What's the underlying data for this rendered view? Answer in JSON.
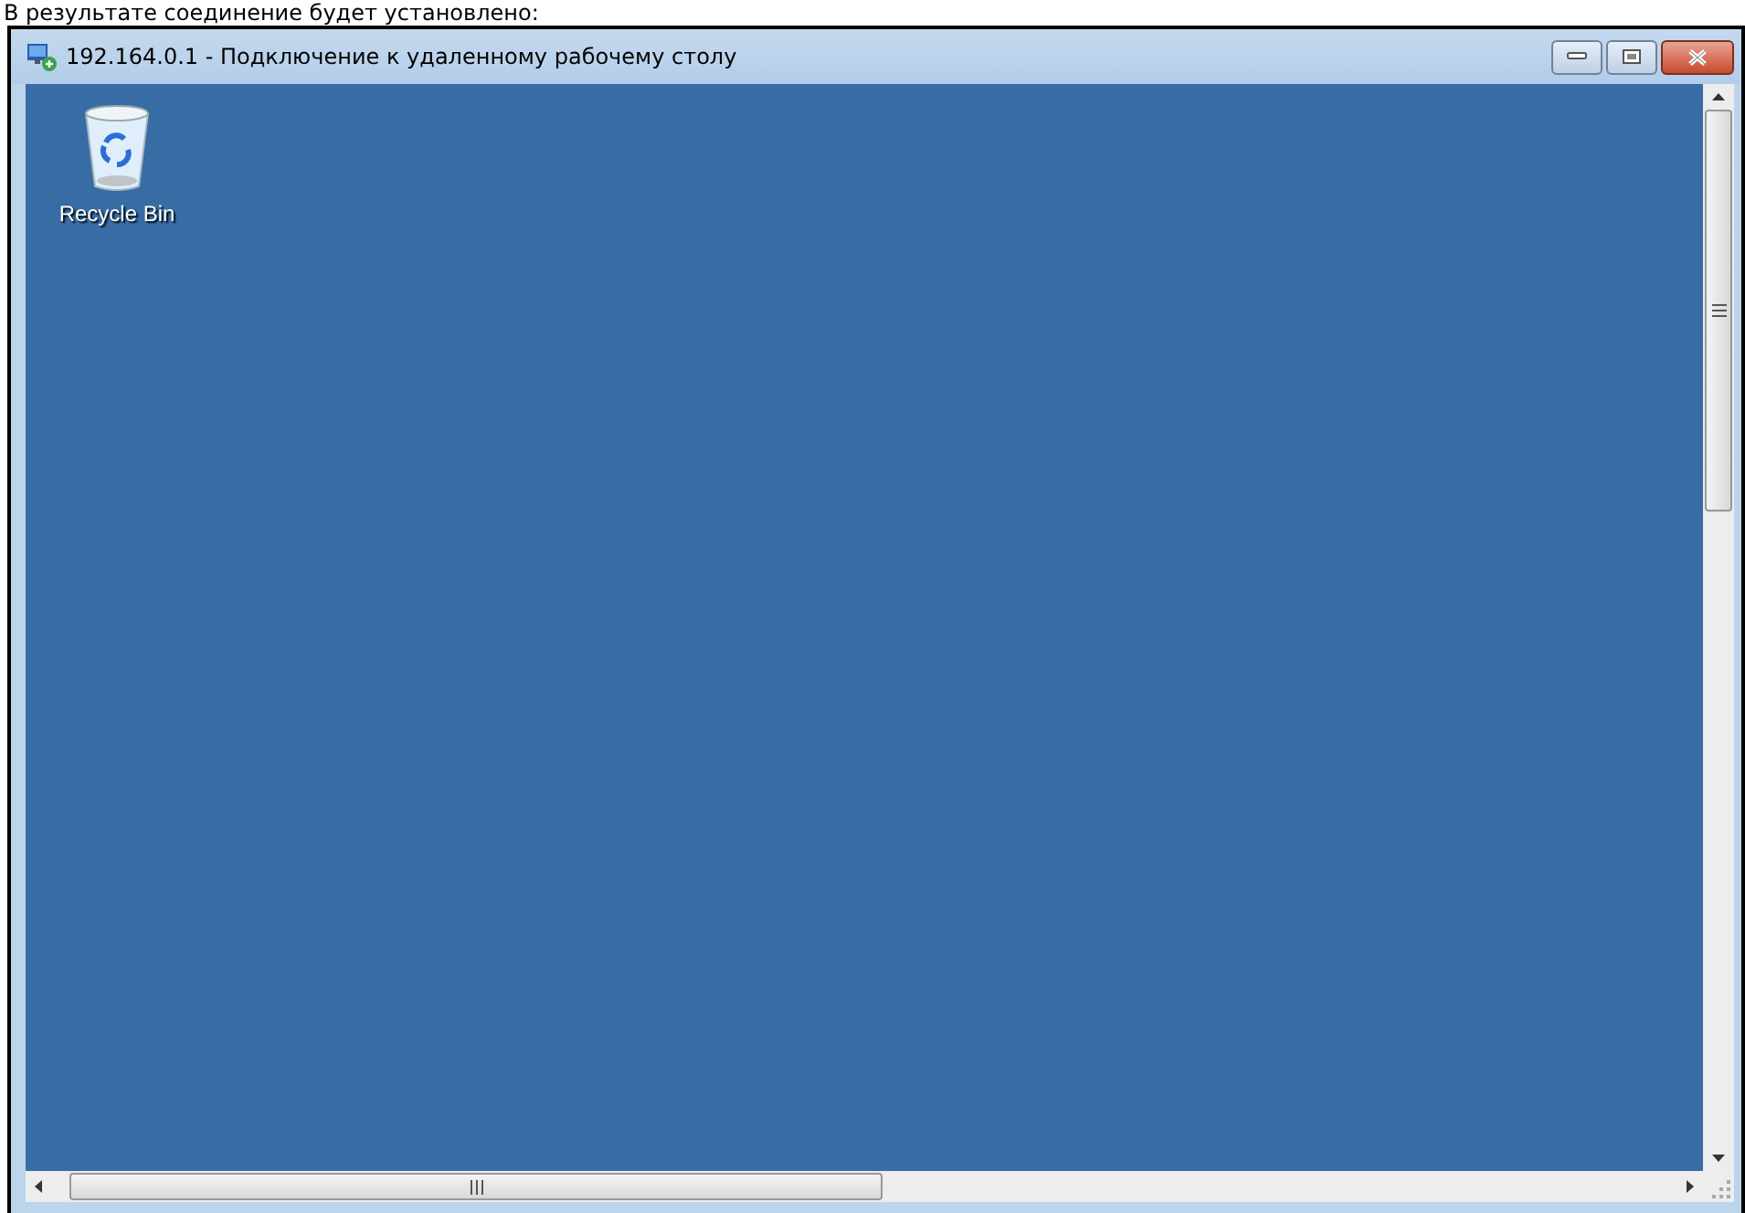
{
  "caption": "В результате соединение будет установлено:",
  "window": {
    "title": "192.164.0.1 - Подключение к удаленному рабочему столу"
  },
  "desktop": {
    "icons": [
      {
        "label": "Recycle Bin"
      }
    ]
  }
}
